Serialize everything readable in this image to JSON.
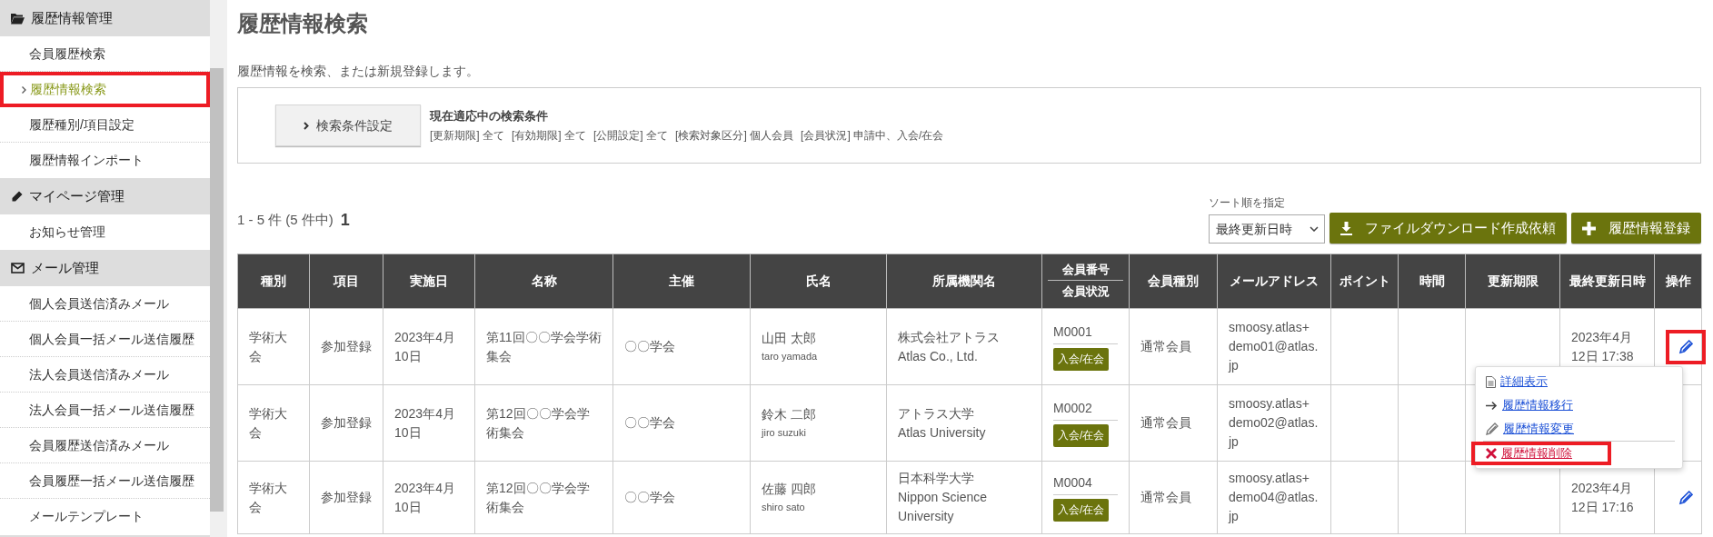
{
  "sidebar": {
    "sections": [
      {
        "title": "履歴情報管理",
        "items": [
          {
            "label": "会員履歴検索",
            "selected": false,
            "highlighted": false
          },
          {
            "label": "履歴情報検索",
            "selected": true,
            "highlighted": true
          },
          {
            "label": "履歴種別/項目設定",
            "selected": false,
            "highlighted": false
          },
          {
            "label": "履歴情報インポート",
            "selected": false,
            "highlighted": false
          }
        ]
      },
      {
        "title": "マイページ管理",
        "items": [
          {
            "label": "お知らせ管理",
            "selected": false,
            "highlighted": false
          }
        ]
      },
      {
        "title": "メール管理",
        "items": [
          {
            "label": "個人会員送信済みメール",
            "selected": false,
            "highlighted": false
          },
          {
            "label": "個人会員一括メール送信履歴",
            "selected": false,
            "highlighted": false
          },
          {
            "label": "法人会員送信済みメール",
            "selected": false,
            "highlighted": false
          },
          {
            "label": "法人会員一括メール送信履歴",
            "selected": false,
            "highlighted": false
          },
          {
            "label": "会員履歴送信済みメール",
            "selected": false,
            "highlighted": false
          },
          {
            "label": "会員履歴一括メール送信履歴",
            "selected": false,
            "highlighted": false
          },
          {
            "label": "メールテンプレート",
            "selected": false,
            "highlighted": false
          }
        ]
      }
    ]
  },
  "page": {
    "title": "履歴情報検索",
    "description": "履歴情報を検索、または新規登録します。"
  },
  "filter": {
    "button": "検索条件設定",
    "heading": "現在適応中の検索条件",
    "conditions": [
      "[更新期限] 全て",
      "[有効期限] 全て",
      "[公開設定] 全て",
      "[検索対象区分] 個人会員",
      "[会員状況] 申請中、入会/在会"
    ]
  },
  "results": {
    "count": "1 - 5 件 (5 件中)",
    "pages": [
      {
        "label": "1",
        "selected": true
      }
    ]
  },
  "sort": {
    "label": "ソート順を指定",
    "value": "最終更新日時"
  },
  "buttons": [
    {
      "label": "ファイルダウンロード作成依頼"
    },
    {
      "label": "履歴情報登録"
    }
  ],
  "table": {
    "columns": [
      "種別",
      "項目",
      "実施日",
      "名称",
      "主催",
      "氏名",
      "所属機関名",
      [
        "会員番号",
        "会員状況"
      ],
      "会員種別",
      "メールアドレス",
      "ポイント",
      "時間",
      "更新期限",
      "最終更新日時",
      "操作"
    ],
    "rows": [
      {
        "type": "学術大会",
        "item": "参加登録",
        "date": "2023年4月10日",
        "title": "第11回〇〇学会学術集会",
        "organizer": "〇〇学会",
        "name": "山田 太郎",
        "name_romaji": "taro yamada",
        "affiliation": [
          "株式会社アトラス",
          "Atlas Co., Ltd."
        ],
        "member_no": "M0001",
        "member_status": "入会/在会",
        "member_type": "通常会員",
        "email": "smoosy.atlas+demo01@atlas.jp",
        "last_updated": "2023年4月12日 17:38",
        "highlighted": true
      },
      {
        "type": "学術大会",
        "item": "参加登録",
        "date": "2023年4月10日",
        "title": "第12回〇〇学会学術集会",
        "organizer": "〇〇学会",
        "name": "鈴木 二郎",
        "name_romaji": "jiro suzuki",
        "affiliation": [
          "アトラス大学",
          "Atlas University"
        ],
        "member_no": "M0002",
        "member_status": "入会/在会",
        "member_type": "通常会員",
        "email": "smoosy.atlas+demo02@atlas.jp"
      },
      {
        "type": "学術大会",
        "item": "参加登録",
        "date": "2023年4月10日",
        "title": "第12回〇〇学会学術集会",
        "organizer": "〇〇学会",
        "name": "佐藤 四郎",
        "name_romaji": "shiro sato",
        "affiliation": [
          "日本科学大学",
          "Nippon Science University"
        ],
        "member_no": "M0004",
        "member_status": "入会/在会",
        "member_type": "通常会員",
        "email": "smoosy.atlas+demo04@atlas.jp",
        "last_updated": "2023年4月12日 17:16",
        "highlighted": false
      }
    ]
  },
  "action_menu": {
    "items": [
      {
        "label": "詳細表示",
        "kind": "normal",
        "highlighted": false
      },
      {
        "label": "履歴情報移行",
        "kind": "normal",
        "highlighted": false
      },
      {
        "label": "履歴情報変更",
        "kind": "normal",
        "highlighted": false
      },
      {
        "label": "履歴情報削除",
        "kind": "danger",
        "highlighted": true
      }
    ]
  }
}
